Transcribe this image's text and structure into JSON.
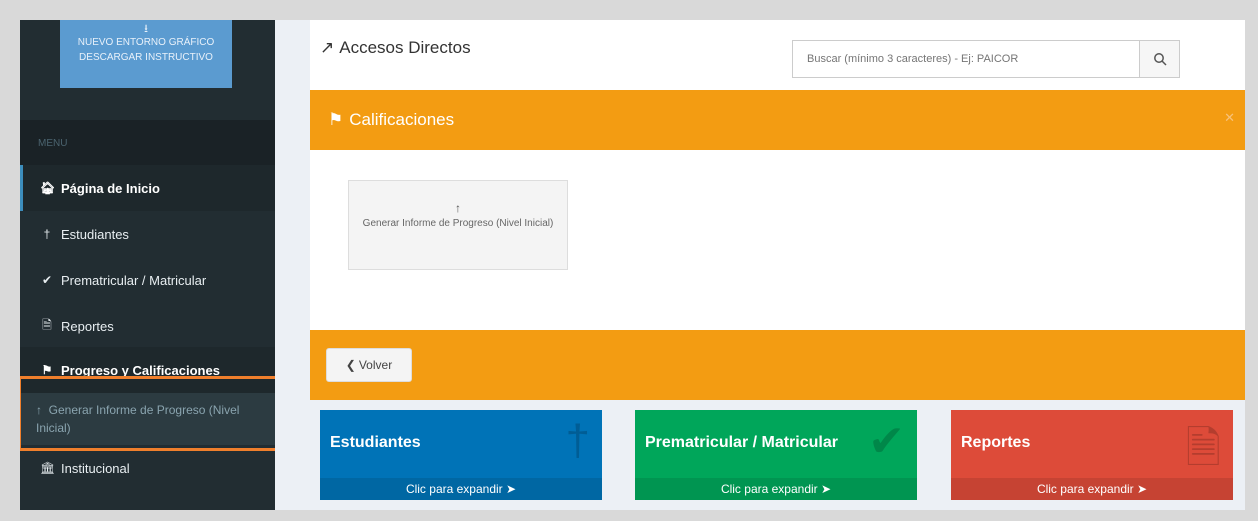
{
  "sidebar": {
    "promo": {
      "line1": "NUEVO ENTORNO GRÁFICO",
      "line2": "DESCARGAR INSTRUCTIVO",
      "icon": "download-icon"
    },
    "menu_header": "MENU",
    "items": [
      {
        "label": "Página de Inicio",
        "icon": "home-icon"
      },
      {
        "label": "Estudiantes",
        "icon": "student-icon"
      },
      {
        "label": "Prematricular / Matricular",
        "icon": "check-icon"
      },
      {
        "label": "Reportes",
        "icon": "file-icon"
      },
      {
        "label": "Progreso y Calificaciones",
        "icon": "flag-icon"
      },
      {
        "label": "Institucional",
        "icon": "institution-icon"
      }
    ],
    "sub_item": {
      "label": "Generar Informe de Progreso (Nivel Inicial)",
      "icon": "upload-icon"
    }
  },
  "header": {
    "title": "Accesos Directos",
    "title_icon": "external-link-icon",
    "search_placeholder": "Buscar (mínimo 3 caracteres) - Ej: PAICOR"
  },
  "section": {
    "title": "Calificaciones",
    "icon": "flag-icon"
  },
  "tile": {
    "label": "Generar Informe de Progreso (Nivel Inicial)",
    "icon": "upload-icon"
  },
  "back_button": {
    "label": "Volver"
  },
  "boxes": [
    {
      "title": "Estudiantes",
      "footer": "Clic para expandir",
      "color": "#0073b7"
    },
    {
      "title": "Prematricular / Matricular",
      "footer": "Clic para expandir",
      "color": "#00a65a"
    },
    {
      "title": "Reportes",
      "footer": "Clic para expandir",
      "color": "#dd4b39"
    }
  ],
  "colors": {
    "sidebar": "#222d32",
    "orange": "#f39c12",
    "highlight": "#f07f2c",
    "accent": "#3c8dbc"
  }
}
